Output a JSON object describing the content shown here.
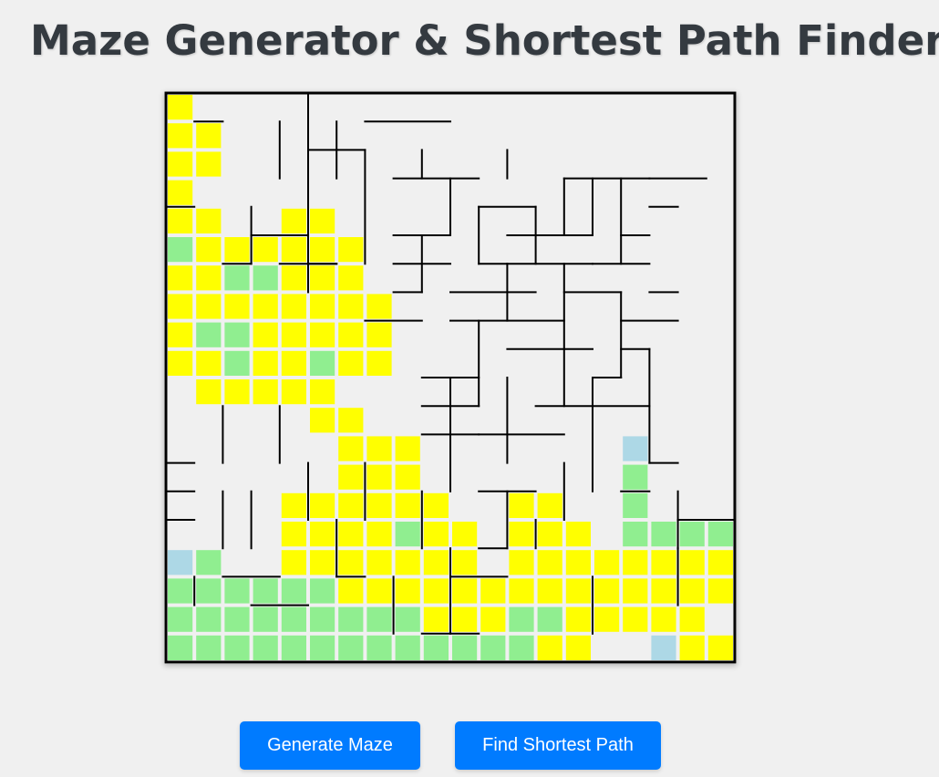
{
  "title": "Maze Generator & Shortest Path Finder",
  "buttons": {
    "generate": "Generate Maze",
    "find_path": "Find Shortest Path"
  },
  "colors": {
    "page_background": "#f0f0f0",
    "title_text": "#343a40",
    "button_background": "#007bff",
    "button_text": "#ffffff",
    "wall": "#000000",
    "cell_empty": "#f0f0f0",
    "cell_explored": "#ffff00",
    "cell_frontier": "#90ee90",
    "cell_endpoint": "#add8e6"
  },
  "maze": {
    "rows": 20,
    "cols": 20,
    "legend": {
      ".": "cell_empty",
      "Y": "cell_explored",
      "G": "cell_frontier",
      "B": "cell_endpoint"
    },
    "cells": [
      "Y...................",
      "YY..................",
      "YY..................",
      "Y...................",
      "YY..YY..............",
      "GYYYYYY.............",
      "YYGGYYY.............",
      "YYYYYYYY............",
      "YGGYYYYY............",
      "YYGYYGYY............",
      ".YYYYY..............",
      ".....YY.............",
      "......YYY.......B...",
      "......YYY.......G...",
      "....YYYYYY..YY..G...",
      "....YYYYGYY.YYY.GGGG",
      "BG..YYYYYYY.YYYYYYYY",
      "GGGGGGYYYYYYYYYYYYYY",
      "GGGGGGGGGYYYGGYYYYY.",
      "GGGGGGGGGGGGGYY..BYY"
    ]
  }
}
